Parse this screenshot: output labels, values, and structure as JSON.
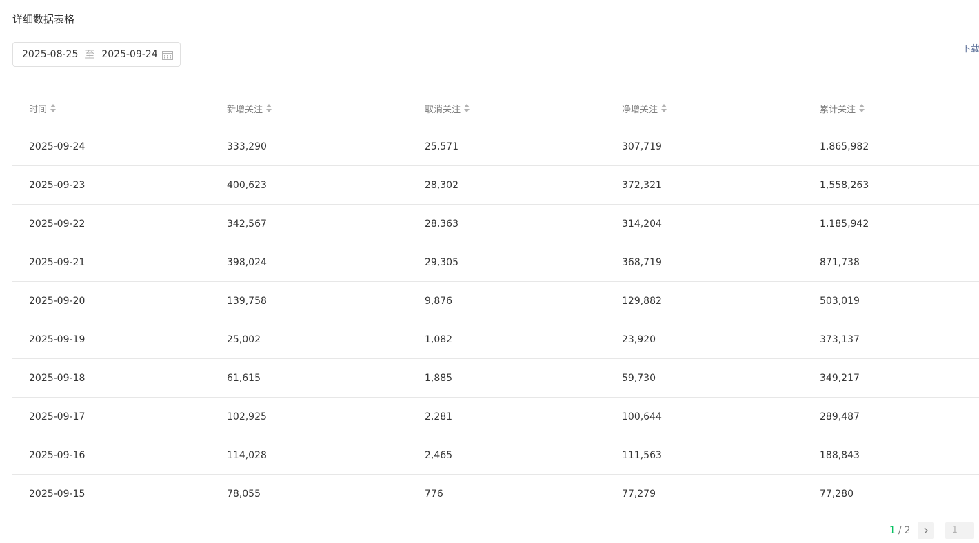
{
  "section": {
    "title": "详细数据表格"
  },
  "date_range": {
    "start": "2025-08-25",
    "separator": "至",
    "end": "2025-09-24"
  },
  "download": {
    "label": "下载"
  },
  "table": {
    "headers": [
      "时间",
      "新增关注",
      "取消关注",
      "净增关注",
      "累计关注"
    ],
    "rows": [
      [
        "2025-09-24",
        "333,290",
        "25,571",
        "307,719",
        "1,865,982"
      ],
      [
        "2025-09-23",
        "400,623",
        "28,302",
        "372,321",
        "1,558,263"
      ],
      [
        "2025-09-22",
        "342,567",
        "28,363",
        "314,204",
        "1,185,942"
      ],
      [
        "2025-09-21",
        "398,024",
        "29,305",
        "368,719",
        "871,738"
      ],
      [
        "2025-09-20",
        "139,758",
        "9,876",
        "129,882",
        "503,019"
      ],
      [
        "2025-09-19",
        "25,002",
        "1,082",
        "23,920",
        "373,137"
      ],
      [
        "2025-09-18",
        "61,615",
        "1,885",
        "59,730",
        "349,217"
      ],
      [
        "2025-09-17",
        "102,925",
        "2,281",
        "100,644",
        "289,487"
      ],
      [
        "2025-09-16",
        "114,028",
        "2,465",
        "111,563",
        "188,843"
      ],
      [
        "2025-09-15",
        "78,055",
        "776",
        "77,279",
        "77,280"
      ]
    ]
  },
  "pagination": {
    "current": "1",
    "separator": "/",
    "total": "2",
    "input_placeholder": "1"
  },
  "icons": {
    "calendar": "calendar-icon",
    "sort": "sort-icon",
    "next": "chevron-right-icon"
  },
  "colors": {
    "accent": "#07c160",
    "link": "#576b95"
  }
}
